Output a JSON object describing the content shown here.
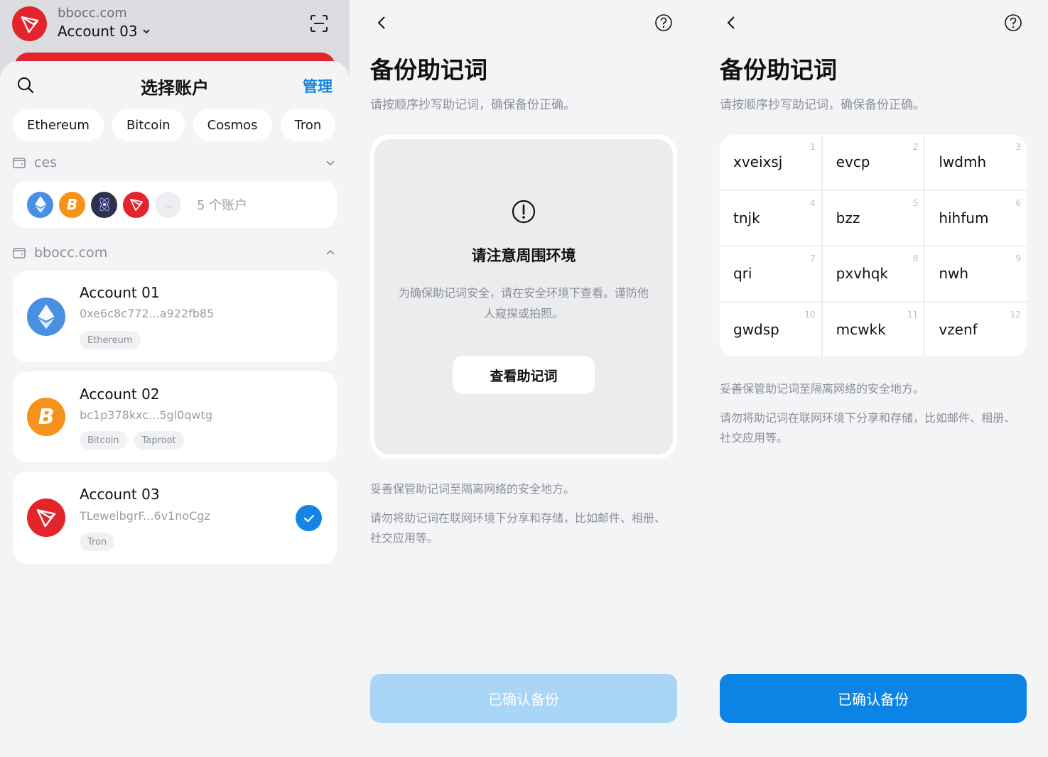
{
  "panel1": {
    "site": "bbocc.com",
    "current_account": "Account 03",
    "sheet_title": "选择账户",
    "manage_label": "管理",
    "chips": [
      "Ethereum",
      "Bitcoin",
      "Cosmos",
      "Tron"
    ],
    "groups": [
      {
        "name": "ces",
        "summary": "5 个账户",
        "more_label": "..."
      },
      {
        "name": "bbocc.com"
      }
    ],
    "accounts": [
      {
        "name": "Account 01",
        "address": "0xe6c8c772...a922fb85",
        "tags": [
          "Ethereum"
        ],
        "chain": "ethereum",
        "selected": false
      },
      {
        "name": "Account 02",
        "address": "bc1p378kxc...5gl0qwtg",
        "tags": [
          "Bitcoin",
          "Taproot"
        ],
        "chain": "bitcoin",
        "selected": false
      },
      {
        "name": "Account 03",
        "address": "TLeweibgrF...6v1noCgz",
        "tags": [
          "Tron"
        ],
        "chain": "tron",
        "selected": true
      }
    ]
  },
  "panel2": {
    "title": "备份助记词",
    "subtitle": "请按顺序抄写助记词，确保备份正确。",
    "warning_title": "请注意周围环境",
    "warning_desc": "为确保助记词安全，请在安全环境下查看。谨防他人窥探或拍照。",
    "view_button": "查看助记词",
    "note1": "妥善保管助记词至隔离网络的安全地方。",
    "note2": "请勿将助记词在联网环境下分享和存储，比如邮件、相册、社交应用等。",
    "confirm_button": "已确认备份"
  },
  "panel3": {
    "title": "备份助记词",
    "subtitle": "请按顺序抄写助记词，确保备份正确。",
    "words": [
      {
        "n": "1",
        "w": "xveixsj"
      },
      {
        "n": "2",
        "w": "evcp"
      },
      {
        "n": "3",
        "w": "lwdmh"
      },
      {
        "n": "4",
        "w": "tnjk"
      },
      {
        "n": "5",
        "w": "bzz"
      },
      {
        "n": "6",
        "w": "hihfum"
      },
      {
        "n": "7",
        "w": "qri"
      },
      {
        "n": "8",
        "w": "pxvhqk"
      },
      {
        "n": "9",
        "w": "nwh"
      },
      {
        "n": "10",
        "w": "gwdsp"
      },
      {
        "n": "11",
        "w": "mcwkk"
      },
      {
        "n": "12",
        "w": "vzenf"
      }
    ],
    "note1": "妥善保管助记词至隔离网络的安全地方。",
    "note2": "请勿将助记词在联网环境下分享和存储，比如邮件、相册、社交应用等。",
    "confirm_button": "已确认备份"
  },
  "colors": {
    "accent": "#1484e6",
    "tron_red": "#e3242b",
    "btc_orange": "#f7931a",
    "eth_blue": "#4a90e2",
    "cosmos_dark": "#2e3148"
  }
}
